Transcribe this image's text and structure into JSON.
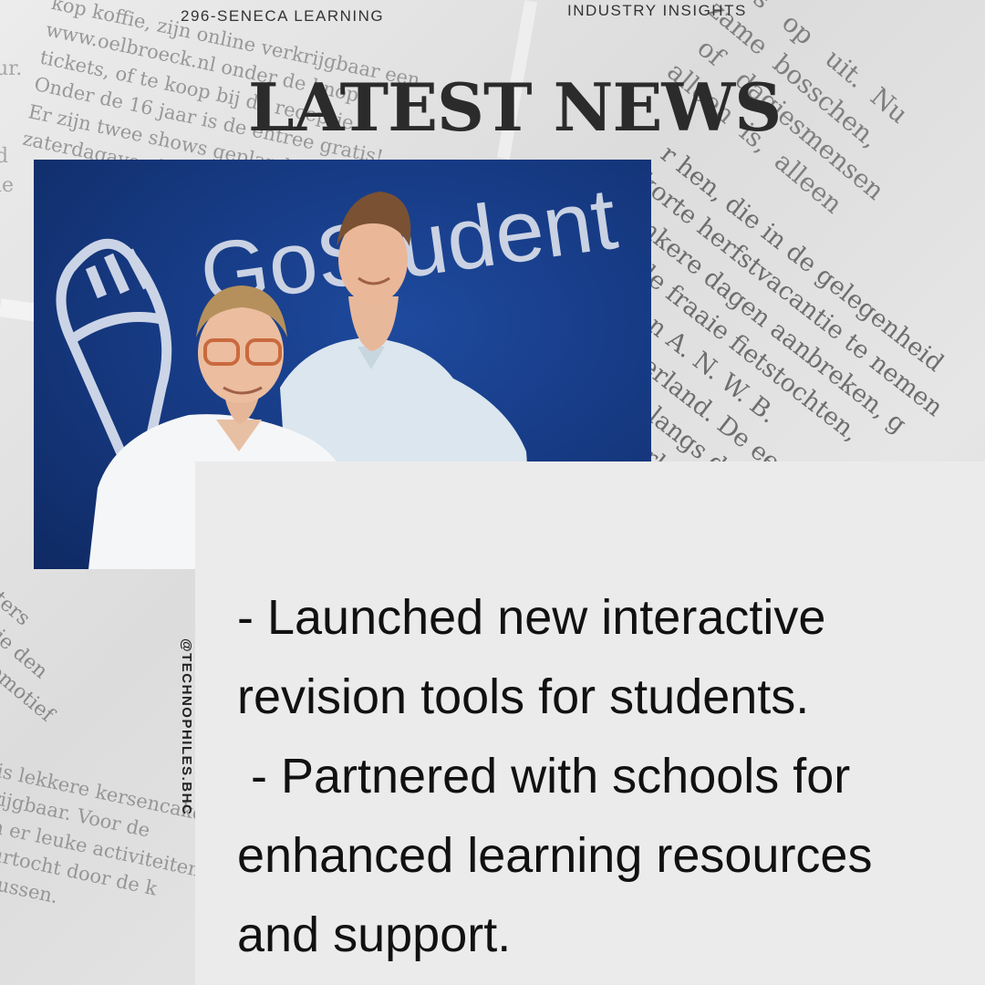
{
  "header": {
    "brand": "296-SENECA LEARNING",
    "section": "INDUSTRY INSIGHTS"
  },
  "headline": "LATEST NEWS",
  "photo": {
    "sign_text": "GoStudent"
  },
  "bullets": [
    "- Launched new interactive",
    "revision tools for students.",
    " - Partnered with schools for",
    "enhanced learning resources",
    "and support."
  ],
  "handle": "@TECHNOPHILES.BHC",
  "colors": {
    "photo_background": "#173b85",
    "panel": "#ebebeb",
    "headline": "#2b2b2b",
    "body_text": "#111111"
  }
}
